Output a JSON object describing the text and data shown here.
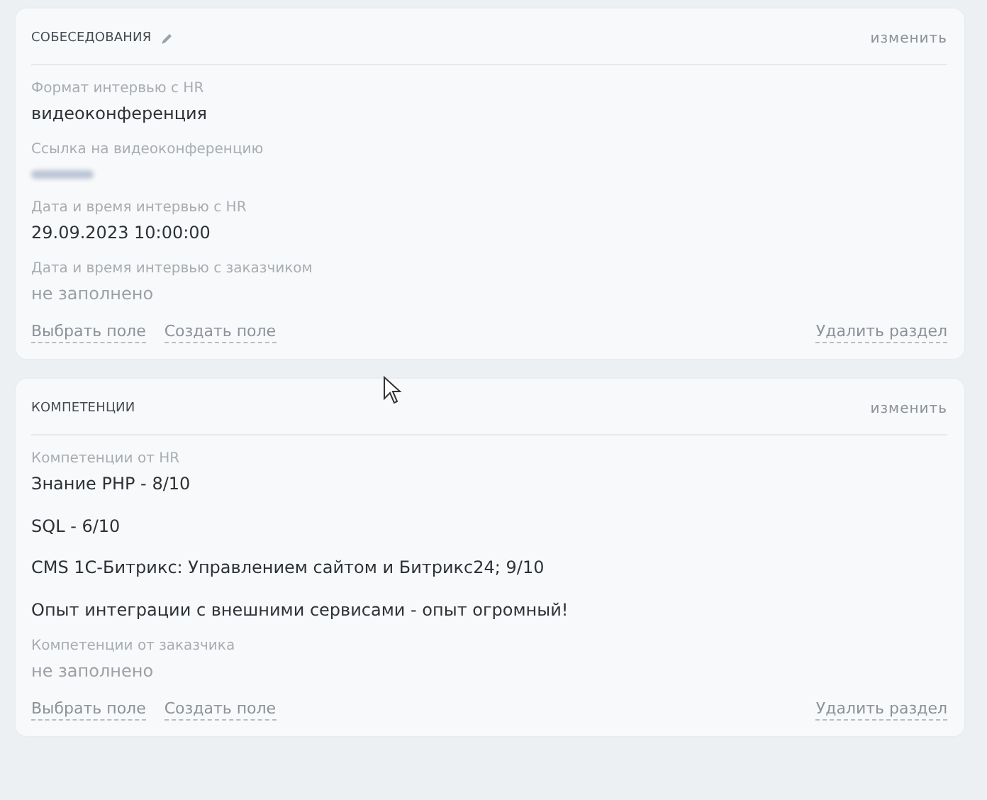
{
  "sections": [
    {
      "title": "СОБЕСЕДОВАНИЯ",
      "title_editable": true,
      "edit_link": "изменить",
      "fields": [
        {
          "label": "Формат интервью с HR",
          "kind": "text",
          "values": [
            "видеоконференция"
          ]
        },
        {
          "label": "Ссылка на видеоконференцию",
          "kind": "redacted"
        },
        {
          "label": "Дата и время интервью с HR",
          "kind": "text",
          "values": [
            "29.09.2023 10:00:00"
          ]
        },
        {
          "label": "Дата и время интервью с заказчиком",
          "kind": "empty",
          "values": [
            "не заполнено"
          ]
        }
      ],
      "actions": [
        "Выбрать поле",
        "Создать поле"
      ],
      "delete_link": "Удалить раздел"
    },
    {
      "title": "КОМПЕТЕНЦИИ",
      "title_editable": false,
      "edit_link": "изменить",
      "fields": [
        {
          "label": "Компетенции от HR",
          "kind": "text",
          "values": [
            "Знание PHP - 8/10",
            "SQL - 6/10",
            "CMS 1С-Битрикс: Управлением сайтом и Битрикс24; 9/10",
            "Опыт интеграции с внешними сервисами - опыт огромный!"
          ]
        },
        {
          "label": "Компетенции от заказчика",
          "kind": "empty",
          "values": [
            "не заполнено"
          ]
        }
      ],
      "actions": [
        "Выбрать поле",
        "Создать поле"
      ],
      "delete_link": "Удалить раздел"
    }
  ]
}
